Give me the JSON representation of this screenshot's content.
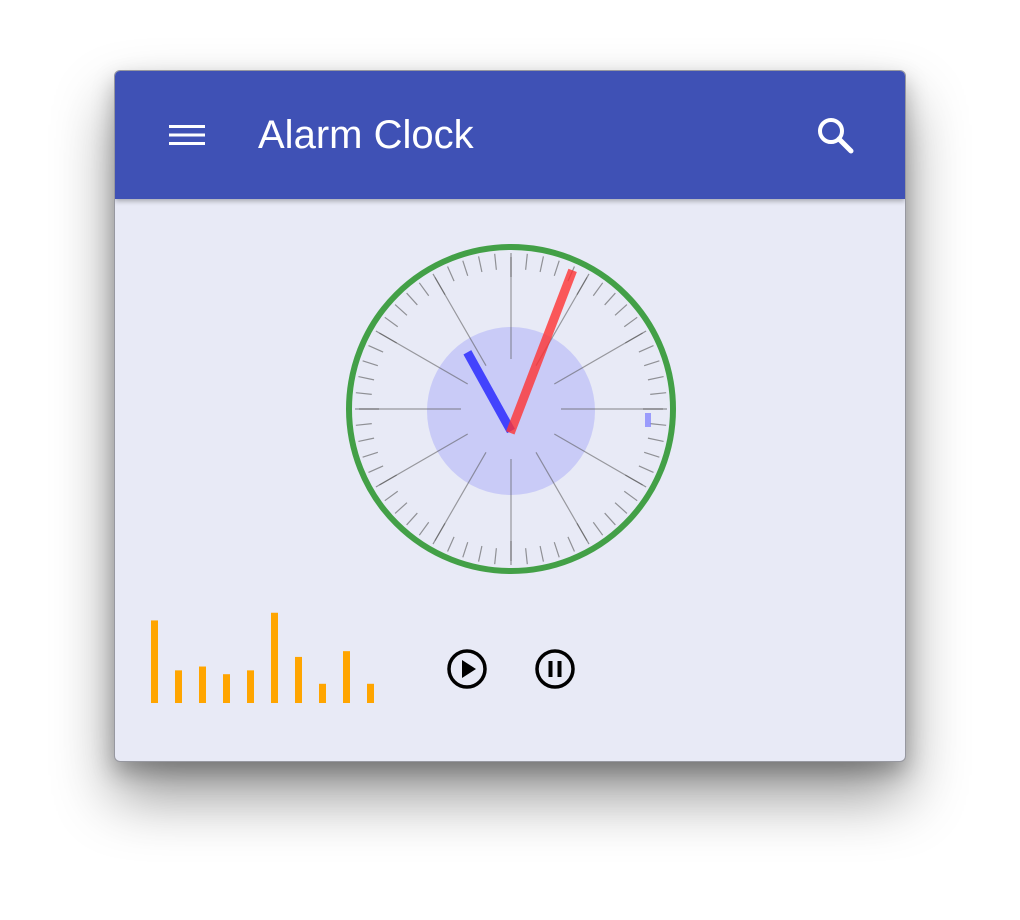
{
  "app": {
    "title": "Alarm Clock"
  },
  "icons": {
    "menu": "menu-icon",
    "search": "search-icon",
    "play": "play-circle-icon",
    "pause": "pause-circle-icon"
  },
  "clock": {
    "time_display": {
      "hour_hand_angle_deg": 331,
      "minute_hand_angle_deg": 21
    },
    "tick_count": 60
  },
  "spectrum": {
    "levels": [
      0.86,
      0.34,
      0.38,
      0.3,
      0.34,
      0.94,
      0.48,
      0.2,
      0.54,
      0.2
    ]
  },
  "colors": {
    "app_bar": "#3f51b5",
    "background": "#e8eaf6",
    "clock_ring": "#43a047",
    "hour_hand": "#2222ff",
    "minute_hand": "#ff3333",
    "clock_highlight": "#c5c8f7",
    "spectrum_bar": "#ffa500"
  }
}
